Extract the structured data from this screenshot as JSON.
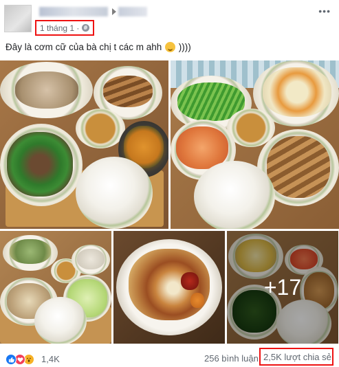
{
  "post": {
    "timestamp": "1 tháng 1 ·",
    "privacy_icon": "globe-icon",
    "more_label": "•••",
    "caption": "Đây là cơm cữ của bà chị t các m ahh",
    "caption_tail": "))))"
  },
  "gallery": {
    "more_photos": "+17"
  },
  "footer": {
    "reaction_icons": [
      "like-icon",
      "love-icon",
      "wow-icon"
    ],
    "reaction_count": "1,4K",
    "comment_count": "256 bình luận",
    "share_count": "2,5K lượt chia sẻ"
  }
}
